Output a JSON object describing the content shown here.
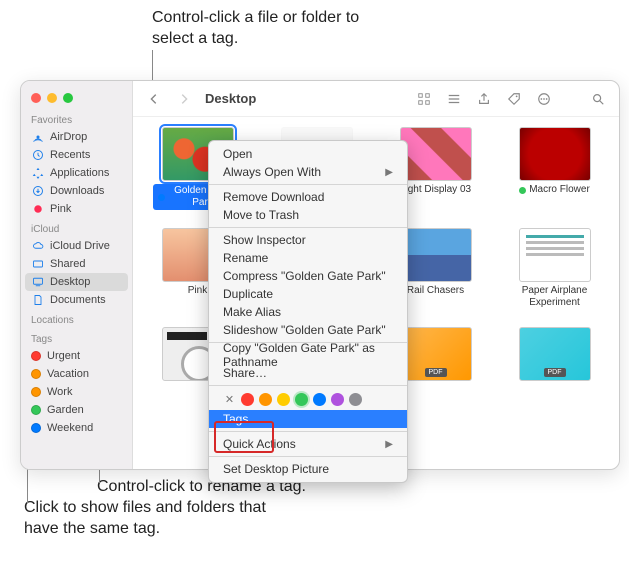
{
  "annotations": {
    "top": "Control-click a file or folder to select a tag.",
    "mid": "Control-click to rename a tag.",
    "bot": "Click to show files and folders that have the same tag."
  },
  "window": {
    "title": "Desktop"
  },
  "sidebar": {
    "sections": {
      "favorites": "Favorites",
      "icloud": "iCloud",
      "locations": "Locations",
      "tags": "Tags"
    },
    "favorites": [
      {
        "label": "AirDrop",
        "icon": "airdrop"
      },
      {
        "label": "Recents",
        "icon": "clock"
      },
      {
        "label": "Applications",
        "icon": "apps"
      },
      {
        "label": "Downloads",
        "icon": "download"
      },
      {
        "label": "Pink",
        "icon": "tag-pink"
      }
    ],
    "icloud": [
      {
        "label": "iCloud Drive",
        "icon": "cloud"
      },
      {
        "label": "Shared",
        "icon": "shared"
      },
      {
        "label": "Desktop",
        "icon": "desktop",
        "selected": true
      },
      {
        "label": "Documents",
        "icon": "doc"
      }
    ],
    "tags": [
      {
        "label": "Urgent",
        "color": "#ff3b30"
      },
      {
        "label": "Vacation",
        "color": "#ff9500"
      },
      {
        "label": "Work",
        "color": "#ff9500"
      },
      {
        "label": "Garden",
        "color": "#34c759"
      },
      {
        "label": "Weekend",
        "color": "#007aff"
      }
    ]
  },
  "files": [
    {
      "name": "Golden Gate Park",
      "thumb": "flowers",
      "selected": true,
      "tag": "#007aff"
    },
    {
      "name": "",
      "thumb": "hidden"
    },
    {
      "name": "Light Display 03",
      "thumb": "light"
    },
    {
      "name": "Macro Flower",
      "thumb": "red",
      "tag": "#34c759"
    },
    {
      "name": "Pink",
      "thumb": "face"
    },
    {
      "name": "",
      "thumb": "hidden2"
    },
    {
      "name": "Rail Chasers",
      "thumb": "rail"
    },
    {
      "name": "Paper Airplane Experiment",
      "thumb": "paper"
    },
    {
      "name": "",
      "thumb": "bland"
    },
    {
      "name": "",
      "thumb": "pile"
    },
    {
      "name": "",
      "thumb": "pdf2"
    },
    {
      "name": "",
      "thumb": "pdf3"
    }
  ],
  "context_menu": {
    "items": [
      {
        "label": "Open"
      },
      {
        "label": "Always Open With",
        "submenu": true
      },
      {
        "sep": true
      },
      {
        "label": "Remove Download"
      },
      {
        "label": "Move to Trash"
      },
      {
        "sep": true
      },
      {
        "label": "Show Inspector"
      },
      {
        "label": "Rename"
      },
      {
        "label": "Compress \"Golden Gate Park\""
      },
      {
        "label": "Duplicate"
      },
      {
        "label": "Make Alias"
      },
      {
        "label": "Slideshow \"Golden Gate Park\""
      },
      {
        "sep": true
      },
      {
        "label": "Copy \"Golden Gate Park\" as Pathname"
      },
      {
        "label": "Share…"
      },
      {
        "sep": true
      },
      {
        "colors": [
          "#ff3b30",
          "#ff9500",
          "#ffcc00",
          "#34c759",
          "#007aff",
          "#af52de",
          "#8e8e93"
        ]
      },
      {
        "label": "Tags…",
        "highlight": true
      },
      {
        "sep": true
      },
      {
        "label": "Quick Actions",
        "submenu": true
      },
      {
        "sep": true
      },
      {
        "label": "Set Desktop Picture"
      }
    ]
  },
  "icons": {
    "pdf_badge": "PDF"
  }
}
